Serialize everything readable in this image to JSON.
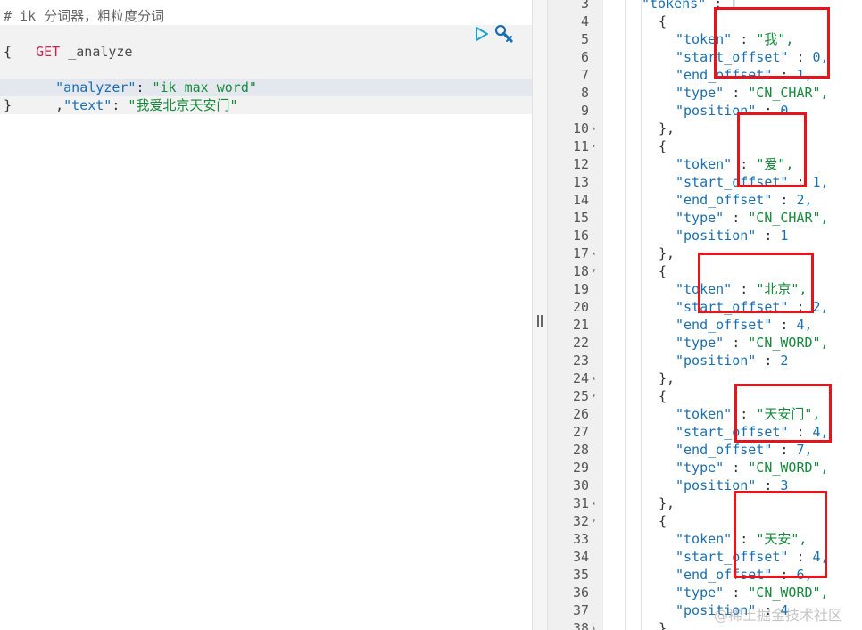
{
  "request": {
    "comment": "# ik 分词器，粗粒度分词",
    "method": "GET",
    "path": "_analyze",
    "open_brace": "{",
    "close_brace": "}",
    "field1_key": "\"analyzer\"",
    "field1_value": "\"ik_max_word\"",
    "field2_prefix": ",",
    "field2_key": "\"text\"",
    "field2_value": "\"我爱北京天安门\"",
    "colon": ": "
  },
  "toolbar": {
    "run_icon": "play-triangle",
    "settings_icon": "wrench",
    "accent": "#1aa2cf"
  },
  "response": {
    "line_numbers": [
      "3",
      "4",
      "5",
      "6",
      "7",
      "8",
      "9",
      "10",
      "11",
      "12",
      "13",
      "14",
      "15",
      "16",
      "17",
      "18",
      "19",
      "20",
      "21",
      "22",
      "23",
      "24",
      "25",
      "26",
      "27",
      "28",
      "29",
      "30",
      "31",
      "32",
      "33",
      "34",
      "35",
      "36",
      "37",
      "38"
    ],
    "lines": [
      {
        "indent": 1,
        "key": "\"tokens\"",
        "sep": " : ",
        "val": "[",
        "valClass": "c-punc"
      },
      {
        "indent": 2,
        "key": "",
        "sep": "",
        "val": "{",
        "valClass": "c-punc"
      },
      {
        "indent": 3,
        "key": "\"token\"",
        "sep": " : ",
        "val": "\"我\",",
        "valClass": "c-str"
      },
      {
        "indent": 3,
        "key": "\"start_offset\"",
        "sep": " : ",
        "val": "0,",
        "valClass": "c-num"
      },
      {
        "indent": 3,
        "key": "\"end_offset\"",
        "sep": " : ",
        "val": "1,",
        "valClass": "c-num"
      },
      {
        "indent": 3,
        "key": "\"type\"",
        "sep": " : ",
        "val": "\"CN_CHAR\",",
        "valClass": "c-str"
      },
      {
        "indent": 3,
        "key": "\"position\"",
        "sep": " : ",
        "val": "0",
        "valClass": "c-num"
      },
      {
        "indent": 2,
        "key": "",
        "sep": "",
        "val": "},",
        "valClass": "c-punc"
      },
      {
        "indent": 2,
        "key": "",
        "sep": "",
        "val": "{",
        "valClass": "c-punc"
      },
      {
        "indent": 3,
        "key": "\"token\"",
        "sep": " : ",
        "val": "\"爱\",",
        "valClass": "c-str"
      },
      {
        "indent": 3,
        "key": "\"start_offset\"",
        "sep": " : ",
        "val": "1,",
        "valClass": "c-num"
      },
      {
        "indent": 3,
        "key": "\"end_offset\"",
        "sep": " : ",
        "val": "2,",
        "valClass": "c-num"
      },
      {
        "indent": 3,
        "key": "\"type\"",
        "sep": " : ",
        "val": "\"CN_CHAR\",",
        "valClass": "c-str"
      },
      {
        "indent": 3,
        "key": "\"position\"",
        "sep": " : ",
        "val": "1",
        "valClass": "c-num"
      },
      {
        "indent": 2,
        "key": "",
        "sep": "",
        "val": "},",
        "valClass": "c-punc"
      },
      {
        "indent": 2,
        "key": "",
        "sep": "",
        "val": "{",
        "valClass": "c-punc"
      },
      {
        "indent": 3,
        "key": "\"token\"",
        "sep": " : ",
        "val": "\"北京\",",
        "valClass": "c-str"
      },
      {
        "indent": 3,
        "key": "\"start_offset\"",
        "sep": " : ",
        "val": "2,",
        "valClass": "c-num"
      },
      {
        "indent": 3,
        "key": "\"end_offset\"",
        "sep": " : ",
        "val": "4,",
        "valClass": "c-num"
      },
      {
        "indent": 3,
        "key": "\"type\"",
        "sep": " : ",
        "val": "\"CN_WORD\",",
        "valClass": "c-str"
      },
      {
        "indent": 3,
        "key": "\"position\"",
        "sep": " : ",
        "val": "2",
        "valClass": "c-num"
      },
      {
        "indent": 2,
        "key": "",
        "sep": "",
        "val": "},",
        "valClass": "c-punc"
      },
      {
        "indent": 2,
        "key": "",
        "sep": "",
        "val": "{",
        "valClass": "c-punc"
      },
      {
        "indent": 3,
        "key": "\"token\"",
        "sep": " : ",
        "val": "\"天安门\",",
        "valClass": "c-str"
      },
      {
        "indent": 3,
        "key": "\"start_offset\"",
        "sep": " : ",
        "val": "4,",
        "valClass": "c-num"
      },
      {
        "indent": 3,
        "key": "\"end_offset\"",
        "sep": " : ",
        "val": "7,",
        "valClass": "c-num"
      },
      {
        "indent": 3,
        "key": "\"type\"",
        "sep": " : ",
        "val": "\"CN_WORD\",",
        "valClass": "c-str"
      },
      {
        "indent": 3,
        "key": "\"position\"",
        "sep": " : ",
        "val": "3",
        "valClass": "c-num"
      },
      {
        "indent": 2,
        "key": "",
        "sep": "",
        "val": "},",
        "valClass": "c-punc"
      },
      {
        "indent": 2,
        "key": "",
        "sep": "",
        "val": "{",
        "valClass": "c-punc"
      },
      {
        "indent": 3,
        "key": "\"token\"",
        "sep": " : ",
        "val": "\"天安\",",
        "valClass": "c-str"
      },
      {
        "indent": 3,
        "key": "\"start_offset\"",
        "sep": " : ",
        "val": "4,",
        "valClass": "c-num"
      },
      {
        "indent": 3,
        "key": "\"end_offset\"",
        "sep": " : ",
        "val": "6,",
        "valClass": "c-num"
      },
      {
        "indent": 3,
        "key": "\"type\"",
        "sep": " : ",
        "val": "\"CN_WORD\",",
        "valClass": "c-str"
      },
      {
        "indent": 3,
        "key": "\"position\"",
        "sep": " : ",
        "val": "4",
        "valClass": "c-num"
      },
      {
        "indent": 2,
        "key": "",
        "sep": "",
        "val": "}",
        "valClass": "c-punc"
      }
    ],
    "fold_lines": [
      "10",
      "11",
      "17",
      "18",
      "24",
      "25",
      "31",
      "32",
      "38"
    ],
    "highlight_color": "#e8141b"
  },
  "watermark": "@稀土掘金技术社区"
}
